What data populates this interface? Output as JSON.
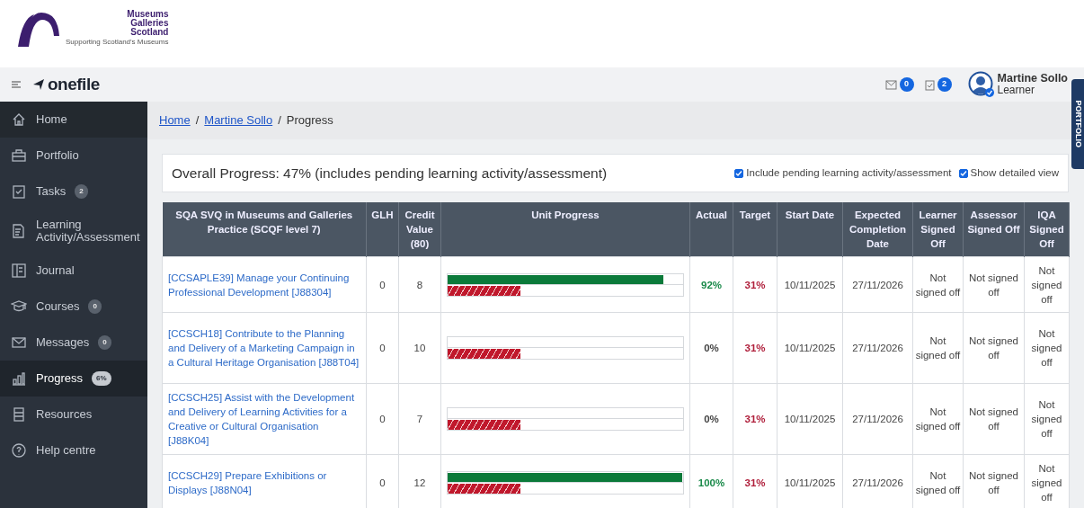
{
  "logo": {
    "lines": [
      "Museums",
      "Galleries",
      "Scotland"
    ],
    "tagline": "Supporting Scotland's Museums"
  },
  "brand": "onefile",
  "header": {
    "messages_count": "0",
    "tasks_count": "2",
    "user_name": "Martine Sollo",
    "user_role": "Learner"
  },
  "side_tab": "PORTFOLIO",
  "sidebar": {
    "items": [
      {
        "label": "Home",
        "selected": false
      },
      {
        "label": "Portfolio",
        "selected": false
      },
      {
        "label": "Tasks",
        "badge": "2",
        "selected": false
      },
      {
        "label": "Learning Activity/Assessment",
        "selected": false
      },
      {
        "label": "Journal",
        "selected": false
      },
      {
        "label": "Courses",
        "badge": "0",
        "selected": false
      },
      {
        "label": "Messages",
        "badge": "0",
        "selected": false
      },
      {
        "label": "Progress",
        "badge": "6%",
        "selected": true
      },
      {
        "label": "Resources",
        "selected": false
      },
      {
        "label": "Help centre",
        "selected": false
      }
    ]
  },
  "breadcrumb_separator": "/",
  "breadcrumb": [
    {
      "label": "Home",
      "kind": "link"
    },
    {
      "label": "Martine Sollo",
      "kind": "link"
    },
    {
      "label": "Progress",
      "kind": "current"
    }
  ],
  "overall": {
    "title": "Overall Progress: 47% (includes pending learning activity/assessment)",
    "options": [
      {
        "label": "Include pending learning activity/assessment",
        "checked": true
      },
      {
        "label": "Show detailed view",
        "checked": true
      }
    ]
  },
  "table": {
    "columns": [
      "SQA SVQ in Museums and Galleries Practice (SCQF level 7)",
      "GLH",
      "Credit Value (80)",
      "Unit Progress",
      "Actual",
      "Target",
      "Start Date",
      "Expected Completion Date",
      "Learner Signed Off",
      "Assessor Signed Off",
      "IQA Signed Off"
    ],
    "rows": [
      {
        "unit": "[CCSAPLE39] Manage your Continuing Professional Development [J88304]",
        "glh": "0",
        "credit": "8",
        "actual_bar": {
          "level": 0.92
        },
        "target_bar": {
          "level": 0.31
        },
        "actual": "92%",
        "target": "31%",
        "start": "10/11/2025",
        "expected": "27/11/2026",
        "learner": "Not signed off",
        "assessor": "Not signed off",
        "iqa": "Not signed off"
      },
      {
        "unit": "[CCSCH18] Contribute to the Planning and Delivery of a Marketing Campaign in a Cultural Heritage Organisation [J88T04]",
        "glh": "0",
        "credit": "10",
        "actual_bar": {
          "level": 0
        },
        "target_bar": {
          "level": 0.31
        },
        "actual": "0%",
        "target": "31%",
        "start": "10/11/2025",
        "expected": "27/11/2026",
        "learner": "Not signed off",
        "assessor": "Not signed off",
        "iqa": "Not signed off"
      },
      {
        "unit": "[CCSCH25] Assist with the Development and Delivery of Learning Activities for a Creative or Cultural Organisation [J88K04]",
        "glh": "0",
        "credit": "7",
        "actual_bar": {
          "level": 0
        },
        "target_bar": {
          "level": 0.31
        },
        "actual": "0%",
        "target": "31%",
        "start": "10/11/2025",
        "expected": "27/11/2026",
        "learner": "Not signed off",
        "assessor": "Not signed off",
        "iqa": "Not signed off"
      },
      {
        "unit": "[CCSCH29] Prepare Exhibitions or Displays [J88N04]",
        "glh": "0",
        "credit": "12",
        "actual_bar": {
          "level": 1
        },
        "target_bar": {
          "level": 0.31
        },
        "actual": "100%",
        "target": "31%",
        "start": "10/11/2025",
        "expected": "27/11/2026",
        "learner": "Not signed off",
        "assessor": "Not signed off",
        "iqa": "Not signed off"
      }
    ]
  }
}
